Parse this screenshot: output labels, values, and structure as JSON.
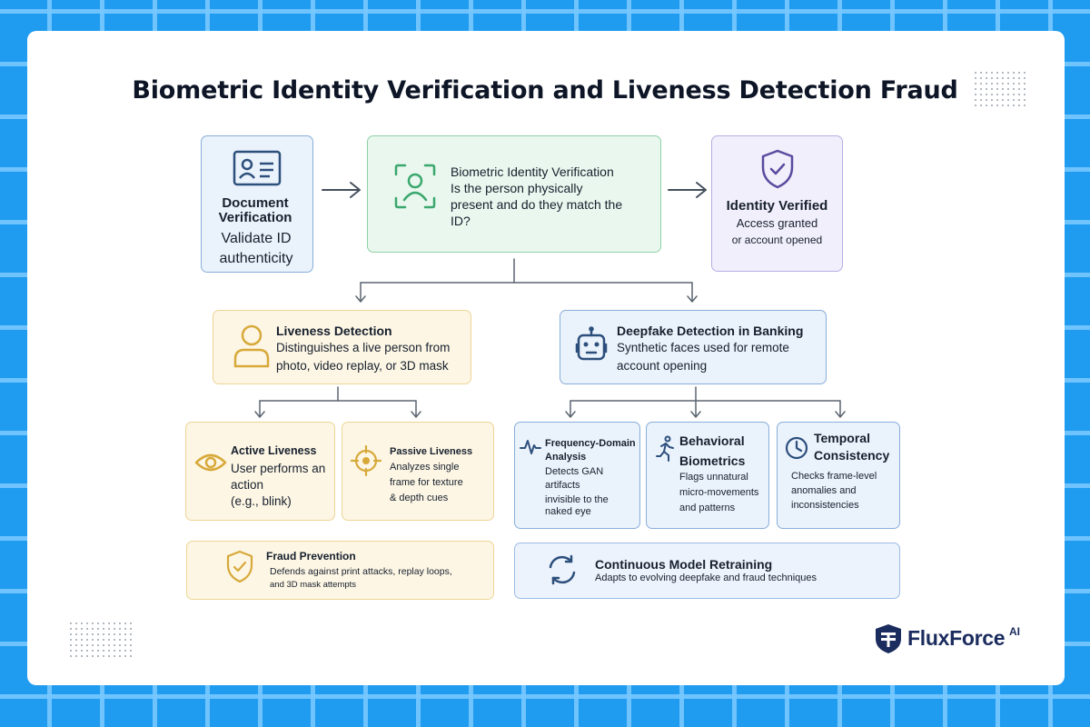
{
  "title": "Biometric Identity Verification and Liveness Detection Fraud",
  "doc": {
    "title": "Document Verification",
    "line1": "Validate ID",
    "line2": "authenticity"
  },
  "bio": {
    "title": "Biometric Identity Verification",
    "line1": "Is the person physically",
    "line2": "present and do they match the",
    "line3": "ID?"
  },
  "verified": {
    "title": "Identity Verified",
    "line1": "Access granted",
    "line2": "or account opened"
  },
  "liveness": {
    "title": "Liveness Detection",
    "line1": "Distinguishes a live person from",
    "line2": "photo, video replay, or 3D mask"
  },
  "deepfake": {
    "title": "Deepfake Detection in Banking",
    "line1": "Synthetic faces used for remote",
    "line2": "account opening"
  },
  "active": {
    "title": "Active Liveness",
    "line1": "User performs an",
    "line2": "action",
    "line3": "(e.g., blink)"
  },
  "passive": {
    "title": "Passive Liveness",
    "line1": "Analyzes single",
    "line2": "frame for texture",
    "line3": "& depth cues"
  },
  "frequency": {
    "title1": "Frequency-Domain",
    "title2": "Analysis",
    "line1": "Detects GAN",
    "line2": "artifacts",
    "line3": "invisible to the",
    "line4": "naked eye"
  },
  "behavioral": {
    "title1": "Behavioral",
    "title2": "Biometrics",
    "line1": "Flags unnatural",
    "line2": "micro-movements",
    "line3": "and patterns"
  },
  "temporal": {
    "title1": "Temporal",
    "title2": "Consistency",
    "line1": "Checks frame-level",
    "line2": "anomalies and",
    "line3": "inconsistencies"
  },
  "fraud": {
    "title": "Fraud Prevention",
    "line1": "Defends against print attacks, replay loops,",
    "line2": "and 3D mask attempts"
  },
  "retrain": {
    "title": "Continuous Model Retraining",
    "line1": "Adapts to evolving deepfake and fraud techniques"
  },
  "logo": {
    "name": "FluxForce",
    "sup": "AI"
  },
  "colors": {
    "background": "#1f9bf0",
    "blue_icon": "#2d4f7c",
    "green_icon": "#3aa76d",
    "purple_icon": "#5a4a9e",
    "yellow_icon": "#d7a93a",
    "logo": "#1b2c5e"
  }
}
